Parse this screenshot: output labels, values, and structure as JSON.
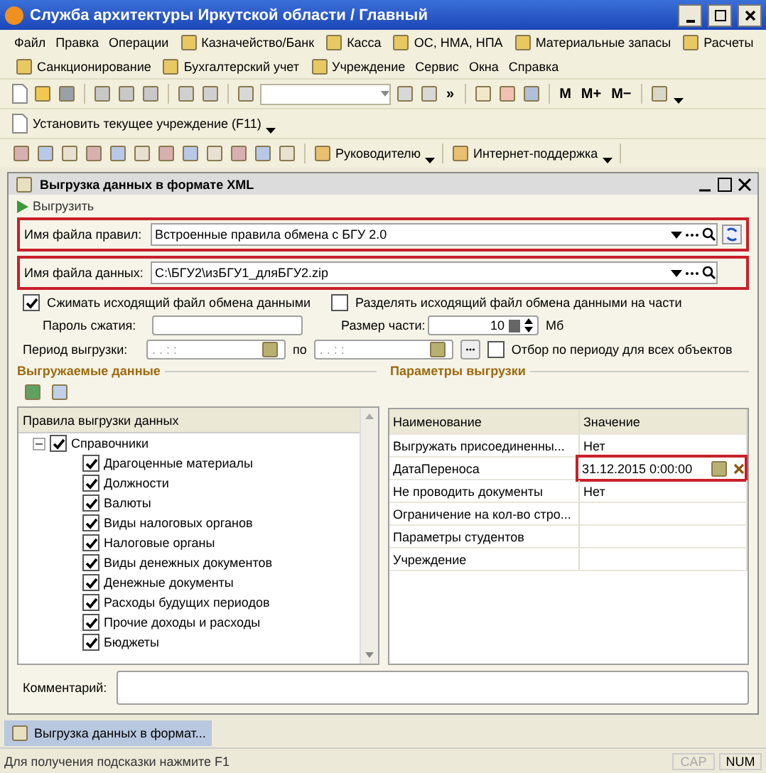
{
  "window": {
    "title": "Служба архитектуры Иркутской области / Главный"
  },
  "menu_rows": [
    [
      {
        "label": "Файл",
        "kind": "plain"
      },
      {
        "label": "Правка",
        "kind": "plain"
      },
      {
        "label": "Операции",
        "kind": "plain"
      },
      {
        "label": "Казначейство/Банк",
        "kind": "icon"
      },
      {
        "label": "Касса",
        "kind": "icon"
      },
      {
        "label": "ОС, НМА, НПА",
        "kind": "icon"
      },
      {
        "label": "Материальные запасы",
        "kind": "icon"
      },
      {
        "label": "Расчеты",
        "kind": "icon"
      }
    ],
    [
      {
        "label": "Санкционирование",
        "kind": "icon"
      },
      {
        "label": "Бухгалтерский учет",
        "kind": "icon"
      },
      {
        "label": "Учреждение",
        "kind": "icon"
      },
      {
        "label": "Сервис",
        "kind": "plain"
      },
      {
        "label": "Окна",
        "kind": "plain"
      },
      {
        "label": "Справка",
        "kind": "plain"
      }
    ]
  ],
  "toolbar": {
    "more": "»",
    "memory_buttons": [
      "M",
      "M+",
      "M−"
    ]
  },
  "set_institution": {
    "label": "Установить текущее учреждение (F11)"
  },
  "panel_toolbar": {
    "items": [
      "Руководителю",
      "Интернет-поддержка"
    ]
  },
  "dialog": {
    "title": "Выгрузка данных в формате XML",
    "command": "Выгрузить",
    "fields": [
      {
        "label": "Имя файла правил:",
        "value": "Встроенные правила обмена с БГУ 2.0",
        "highlighted": true,
        "kind": "rules"
      },
      {
        "label": "Имя файла данных:",
        "value": "C:\\БГУ2\\изБГУ1_дляБГУ2.zip",
        "highlighted": true,
        "kind": "data"
      }
    ],
    "compress": {
      "label": "Сжимать исходящий файл обмена данными",
      "checked": true
    },
    "split": {
      "label": "Разделять исходящий файл обмена данными на части",
      "checked": false
    },
    "password": {
      "label": "Пароль сжатия:"
    },
    "part_size": {
      "label": "Размер части:",
      "value": "10",
      "unit": "Мб"
    },
    "period": {
      "label": "Период выгрузки:",
      "from_placeholder": ". .   : :",
      "to_label": "по",
      "to_placeholder": ". .   : :"
    },
    "period_filter": {
      "label": "Отбор по периоду для всех объектов",
      "checked": false
    },
    "sections": [
      "Выгружаемые данные",
      "Параметры выгрузки"
    ],
    "tree": {
      "header": "Правила выгрузки данных",
      "items": [
        {
          "label": "Справочники",
          "checked": true,
          "expanded": true,
          "children": [
            {
              "label": "Драгоценные материалы",
              "checked": true
            },
            {
              "label": "Должности",
              "checked": true
            },
            {
              "label": "Валюты",
              "checked": true
            },
            {
              "label": "Виды налоговых органов",
              "checked": true
            },
            {
              "label": "Налоговые органы",
              "checked": true
            },
            {
              "label": "Виды денежных документов",
              "checked": true
            },
            {
              "label": "Денежные документы",
              "checked": true
            },
            {
              "label": "Расходы будущих периодов",
              "checked": true
            },
            {
              "label": "Прочие доходы и расходы",
              "checked": true
            },
            {
              "label": "Бюджеты",
              "checked": true
            }
          ]
        }
      ]
    },
    "params": {
      "columns": [
        "Наименование",
        "Значение"
      ],
      "rows": [
        {
          "name": "Выгружать присоединенны...",
          "value": "Нет",
          "editing": false
        },
        {
          "name": "ДатаПереноса",
          "value": "31.12.2015  0:00:00",
          "editing": true
        },
        {
          "name": "Не проводить документы",
          "value": "Нет",
          "editing": false
        },
        {
          "name": "Ограничение на кол-во стро...",
          "editing": false
        },
        {
          "name": "Параметры студентов",
          "editing": false
        },
        {
          "name": "Учреждение",
          "editing": false
        }
      ]
    },
    "comment": {
      "label": "Комментарий:"
    }
  },
  "taskbar": [
    {
      "label": "Выгрузка данных в формат...",
      "selected": true
    }
  ],
  "status_bar": {
    "hint": "Для получения подсказки нажмите F1",
    "keys": [
      {
        "label": "CAP",
        "on": false
      },
      {
        "label": "NUM",
        "on": true
      }
    ]
  }
}
